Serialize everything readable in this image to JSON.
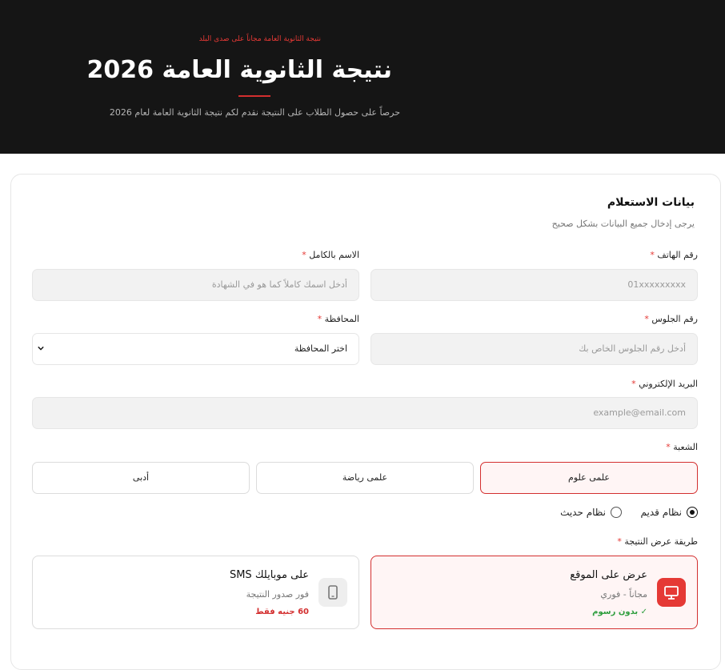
{
  "hero": {
    "tagline": "نتيجة الثانوية العامة مجاناً على صدى البلد",
    "title": "نتيجة الثانوية العامة 2026",
    "description": "حرصاً على حصول الطلاب على النتيجة نقدم لكم نتيجة الثانوية العامة لعام 2026"
  },
  "form": {
    "title": "بيانات الاستعلام",
    "subtitle": "يرجى إدخال جميع البيانات بشكل صحيح",
    "required_mark": "*",
    "phone": {
      "label": "رقم الهاتف",
      "placeholder": "01xxxxxxxxx"
    },
    "name": {
      "label": "الاسم بالكامل",
      "placeholder": "أدخل اسمك كاملاً كما هو في الشهادة"
    },
    "seat": {
      "label": "رقم الجلوس",
      "placeholder": "أدخل رقم الجلوس الخاص بك"
    },
    "governorate": {
      "label": "المحافظة",
      "value": "اختر المحافظة"
    },
    "email": {
      "label": "البريد الإلكتروني",
      "placeholder": "example@email.com"
    },
    "branch": {
      "label": "الشعبة",
      "options": [
        "علمى علوم",
        "علمى رياضة",
        "أدبى"
      ],
      "selected": "علمى علوم"
    },
    "system": {
      "options": [
        "نظام قديم",
        "نظام حديث"
      ],
      "selected": "نظام قديم"
    },
    "method": {
      "label": "طريقة عرض النتيجة",
      "site": {
        "title": "عرض على الموقع",
        "subtitle": "مجاناً - فوري",
        "price": "✓ بدون رسوم"
      },
      "sms": {
        "title": "على موبايلك SMS",
        "subtitle": "فور صدور النتيجة",
        "price": "60 جنيه فقط"
      }
    }
  },
  "colors": {
    "accent": "#d32f2f",
    "success": "#2e9e3e",
    "dark": "#151515"
  }
}
